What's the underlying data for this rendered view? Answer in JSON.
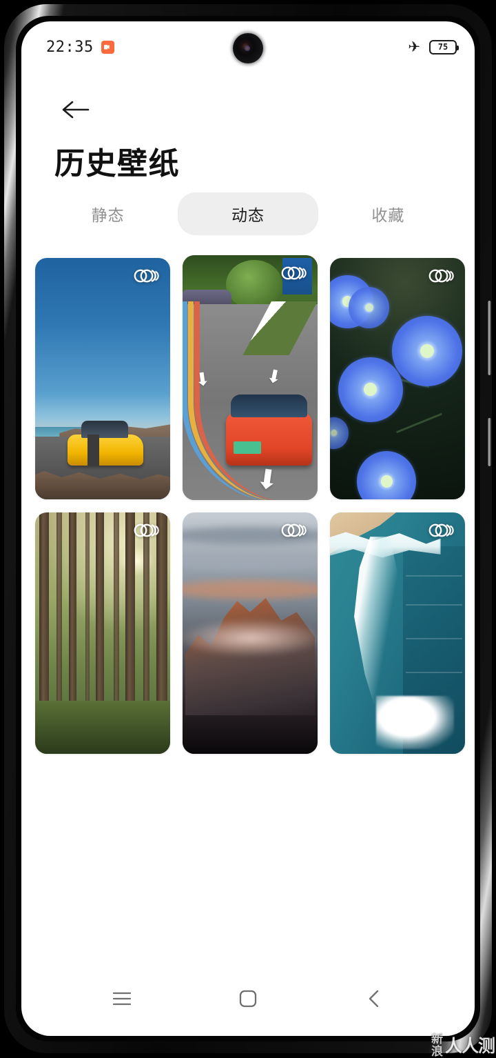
{
  "status_bar": {
    "clock": "22:35",
    "screen_record_icon": "screen-record-icon",
    "airplane_icon": "airplane-mode-icon",
    "airplane_glyph": "✈",
    "battery_level": "75",
    "battery_icon": "battery-icon",
    "camera_icon": "front-camera-punch-hole"
  },
  "app_bar": {
    "back_icon": "back-arrow-icon",
    "title": "历史壁纸"
  },
  "tabs": [
    {
      "label": "静态",
      "name": "tab-static",
      "selected": false
    },
    {
      "label": "动态",
      "name": "tab-dynamic",
      "selected": true
    },
    {
      "label": "收藏",
      "name": "tab-favorites",
      "selected": false
    }
  ],
  "wallpapers": [
    {
      "name": "wallpaper-card-yellow-car-coast",
      "description": "黄色跑车海岸公路",
      "badge": "live-wallpaper-badge"
    },
    {
      "name": "wallpaper-card-orange-car-road",
      "description": "橙色汽车彩色车道",
      "badge": "live-wallpaper-badge"
    },
    {
      "name": "wallpaper-card-blue-flowers",
      "description": "蓝色亚麻花",
      "badge": "live-wallpaper-badge"
    },
    {
      "name": "wallpaper-card-sunlit-forest",
      "description": "阳光森林",
      "badge": "live-wallpaper-badge"
    },
    {
      "name": "wallpaper-card-sunset-mountain",
      "description": "日落山峰云海",
      "badge": "live-wallpaper-badge"
    },
    {
      "name": "wallpaper-card-ocean-wave",
      "description": "海浪沙滩",
      "badge": "live-wallpaper-badge"
    }
  ],
  "nav_bar": {
    "recents_icon": "recents-menu-icon",
    "home_icon": "home-square-icon",
    "back_icon": "back-chevron-icon"
  },
  "watermark": {
    "brand_top": "新",
    "brand_bottom": "浪",
    "main": "人人测"
  },
  "colors": {
    "accent_record": "#fb6a3c",
    "tab_selected_bg": "#eeeeee",
    "tab_selected_text": "#1d1d1d",
    "tab_text": "#909090",
    "screen_bg": "#ffffff",
    "title_text": "#111111"
  }
}
